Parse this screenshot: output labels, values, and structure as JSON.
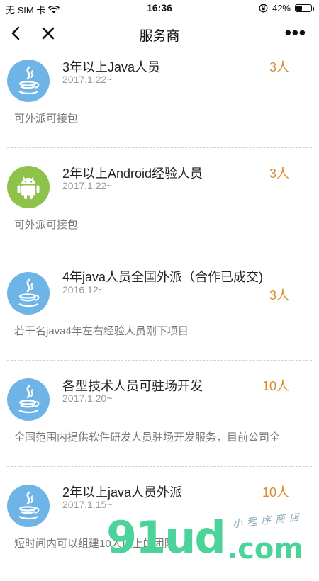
{
  "status": {
    "carrier": "无 SIM 卡",
    "time": "16:36",
    "battery": "42%",
    "battery_level": 0.42
  },
  "nav": {
    "title": "服务商"
  },
  "items": [
    {
      "icon": "java-icon",
      "title": "3年以上Java人员",
      "date": "2017.1.22~",
      "count": "3人",
      "desc": "可外派可接包"
    },
    {
      "icon": "android-icon",
      "title": "2年以上Android经验人员",
      "date": "2017.1.22~",
      "count": "3人",
      "desc": "可外派可接包"
    },
    {
      "icon": "java-icon",
      "title": "4年java人员全国外派（合作已成交)",
      "date": "2016.12~",
      "count": "3人",
      "desc": "若干名java4年左右经验人员刚下项目"
    },
    {
      "icon": "java-icon",
      "title": "各型技术人员可驻场开发",
      "date": "2017.1.20~",
      "count": "10人",
      "desc": "全国范围内提供软件研发人员驻场开发服务，目前公司全"
    },
    {
      "icon": "java-icon",
      "title": "2年以上java人员外派",
      "date": "2017.1.15~",
      "count": "10人",
      "desc": "短时间内可以组建10人以上的团队"
    }
  ],
  "watermark": {
    "brand": "91ud",
    "domain": ".com",
    "tagline": "小程序商店"
  }
}
